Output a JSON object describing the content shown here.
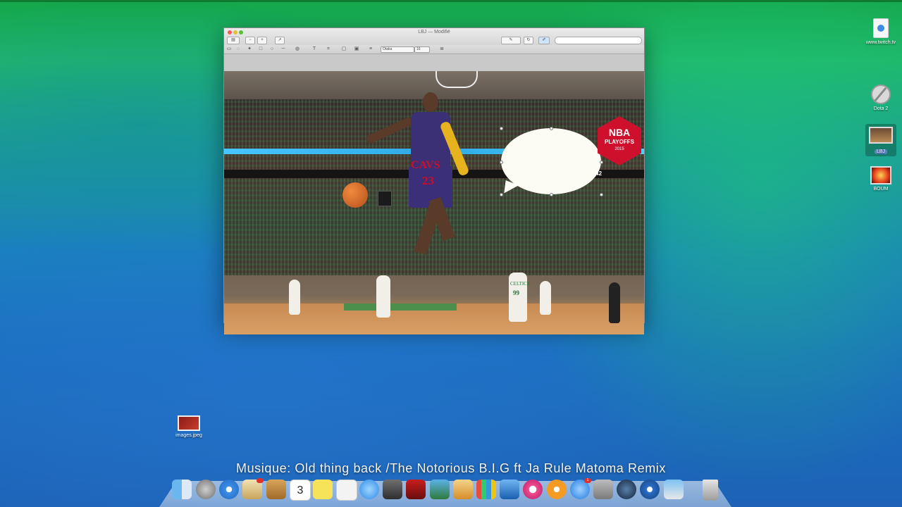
{
  "window": {
    "title": "LBJ — Modifié",
    "font_select": "Otaka",
    "size_select": "16"
  },
  "image": {
    "jersey_name": "CAVS",
    "jersey_number": "23",
    "celtics_text": "CELTICS",
    "celtics_number": "99",
    "badge": {
      "line1": "NBA",
      "line2": "PLAYOFFS",
      "line3": "2015"
    },
    "scoreboard_time": "0:42"
  },
  "desktop": {
    "icons": [
      {
        "label": "www.twitch.tv",
        "icon": "webloc-document-icon"
      },
      {
        "label": "Dota 2",
        "icon": "no-entry-icon"
      },
      {
        "label": "LBJ",
        "icon": "image-thumbnail-icon"
      },
      {
        "label": "BOUM",
        "icon": "explosion-thumbnail-icon"
      },
      {
        "label": "images.jpeg",
        "icon": "jpeg-thumbnail-icon"
      }
    ]
  },
  "caption": "Musique: Old thing back /The Notorious B.I.G ft Ja Rule Matoma Remix",
  "dock": {
    "calendar_day": "3",
    "mail_badge": "",
    "appstore_badge": "1",
    "apps": [
      "Finder",
      "Launchpad",
      "Safari",
      "Mail",
      "Contacts",
      "Calendar",
      "Notes",
      "Reminders",
      "Messages",
      "FaceTime",
      "Photo Booth",
      "Preview",
      "iPhoto",
      "Pages",
      "Numbers",
      "Keynote",
      "iTunes",
      "iBooks",
      "App Store",
      "System Preferences",
      "Steam",
      "QuickTime",
      "Preview Editor",
      "Trash"
    ]
  },
  "colors": {
    "accent_red": "#cf102d",
    "cavs_wine": "#3b2f76"
  }
}
